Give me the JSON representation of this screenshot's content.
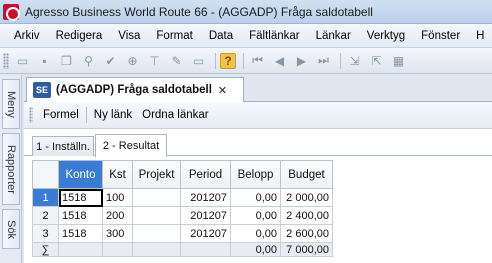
{
  "window": {
    "title": "Agresso Business World Route 66 - (AGGADP) Fråga saldotabell"
  },
  "menu": [
    "Arkiv",
    "Redigera",
    "Visa",
    "Format",
    "Data",
    "Fältlänkar",
    "Länkar",
    "Verktyg",
    "Fönster",
    "H"
  ],
  "toolbar": {
    "icons": [
      "new-icon",
      "save-icon",
      "copy-icon",
      "find-icon",
      "check-icon",
      "zoom-icon",
      "filter-icon",
      "edit-icon",
      "blank-icon",
      "help-icon",
      "first-icon",
      "prev-icon",
      "next-icon",
      "last-icon",
      "insert-row-icon",
      "delete-row-icon",
      "grid-icon"
    ],
    "help_label": "?"
  },
  "left_strip": {
    "tabs": [
      "Meny",
      "Rapporter",
      "Sök"
    ]
  },
  "doc_tab": {
    "badge": "SE",
    "label": "(AGGADP) Fråga saldotabell",
    "close": "✕"
  },
  "sub_toolbar": {
    "formel": "Formel",
    "ny_lank": "Ny länk",
    "ordna_lankar": "Ordna länkar"
  },
  "inner_tabs": [
    {
      "label": "1 - Inställn.",
      "active": false
    },
    {
      "label": "2 - Resultat",
      "active": true
    }
  ],
  "grid": {
    "columns": [
      "Konto",
      "Kst",
      "Projekt",
      "Period",
      "Belopp",
      "Budget"
    ],
    "rows": [
      {
        "num": "1",
        "konto": "1518",
        "kst": "100",
        "projekt": "",
        "period": "201207",
        "belopp": "0,00",
        "budget": "2 000,00"
      },
      {
        "num": "2",
        "konto": "1518",
        "kst": "200",
        "projekt": "",
        "period": "201207",
        "belopp": "0,00",
        "budget": "2 400,00"
      },
      {
        "num": "3",
        "konto": "1518",
        "kst": "300",
        "projekt": "",
        "period": "201207",
        "belopp": "0,00",
        "budget": "2 600,00"
      }
    ],
    "sum_row": {
      "symbol": "∑",
      "belopp": "0,00",
      "budget": "7 000,00"
    }
  },
  "colors": {
    "accent": "#3a7bd5",
    "titlebar": "#c5daf0"
  }
}
